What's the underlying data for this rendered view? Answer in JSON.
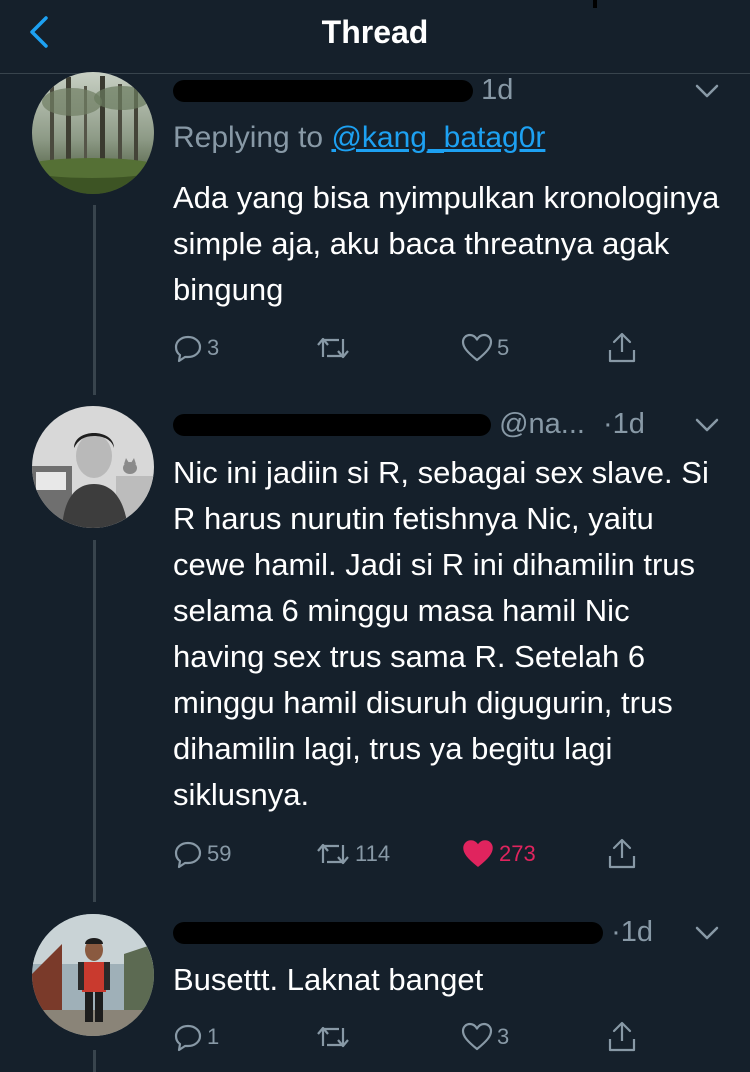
{
  "header": {
    "title": "Thread",
    "back_icon": "chevron-left-icon"
  },
  "colors": {
    "background": "#15202b",
    "accent": "#1da1f2",
    "muted": "#8899a6",
    "like": "#e0245e",
    "divider": "#38444d"
  },
  "tweets": [
    {
      "handle_visible": "",
      "time": "1d",
      "replying_label": "Replying to",
      "replying_to": "@kang_batag0r",
      "text": "Ada yang bisa nyimpulkan kronologinya simple aja, aku baca threatnya agak bingung",
      "replies": "3",
      "retweets": "",
      "likes": "5",
      "liked": false
    },
    {
      "handle_visible": "@na...",
      "time": "·1d",
      "text": "Nic ini jadiin si R, sebagai sex slave. Si R harus nurutin fetishnya Nic, yaitu cewe hamil. Jadi si R ini dihamilin trus selama 6 minggu masa hamil Nic having sex trus sama R. Setelah 6 minggu hamil disuruh digugurin, trus dihamilin lagi, trus ya begitu lagi siklusnya.",
      "replies": "59",
      "retweets": "114",
      "likes": "273",
      "liked": true
    },
    {
      "handle_visible": "",
      "time": "·1d",
      "text": "Busettt. Laknat banget",
      "replies": "1",
      "retweets": "",
      "likes": "3",
      "liked": false
    }
  ]
}
